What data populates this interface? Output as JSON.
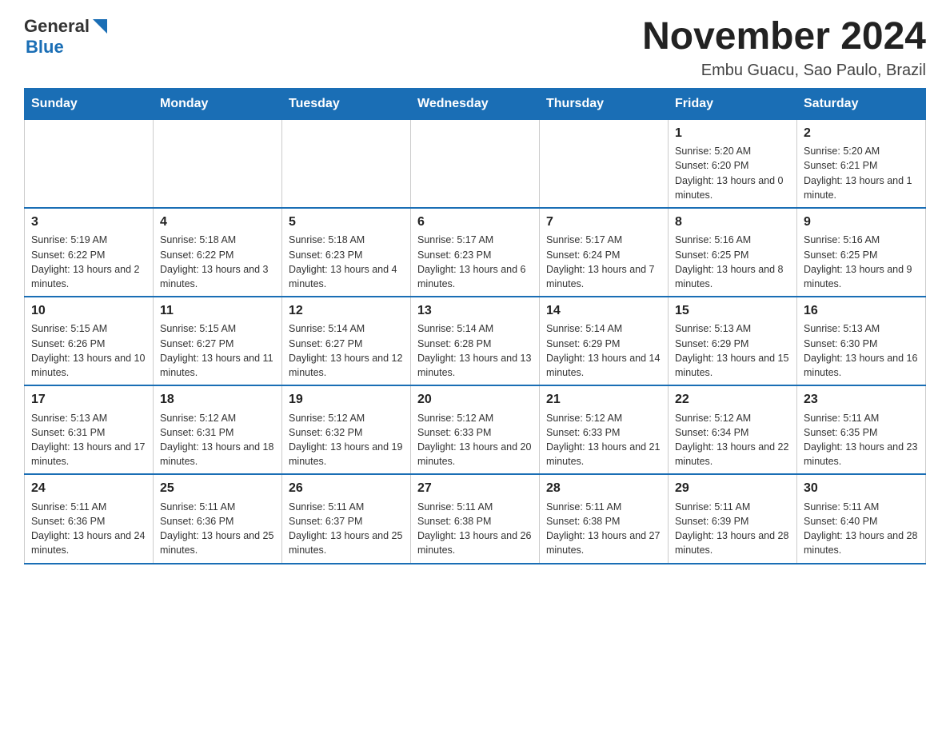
{
  "header": {
    "logo_general": "General",
    "logo_blue": "Blue",
    "month_title": "November 2024",
    "location": "Embu Guacu, Sao Paulo, Brazil"
  },
  "weekdays": [
    "Sunday",
    "Monday",
    "Tuesday",
    "Wednesday",
    "Thursday",
    "Friday",
    "Saturday"
  ],
  "weeks": [
    [
      {
        "day": "",
        "info": ""
      },
      {
        "day": "",
        "info": ""
      },
      {
        "day": "",
        "info": ""
      },
      {
        "day": "",
        "info": ""
      },
      {
        "day": "",
        "info": ""
      },
      {
        "day": "1",
        "info": "Sunrise: 5:20 AM\nSunset: 6:20 PM\nDaylight: 13 hours and 0 minutes."
      },
      {
        "day": "2",
        "info": "Sunrise: 5:20 AM\nSunset: 6:21 PM\nDaylight: 13 hours and 1 minute."
      }
    ],
    [
      {
        "day": "3",
        "info": "Sunrise: 5:19 AM\nSunset: 6:22 PM\nDaylight: 13 hours and 2 minutes."
      },
      {
        "day": "4",
        "info": "Sunrise: 5:18 AM\nSunset: 6:22 PM\nDaylight: 13 hours and 3 minutes."
      },
      {
        "day": "5",
        "info": "Sunrise: 5:18 AM\nSunset: 6:23 PM\nDaylight: 13 hours and 4 minutes."
      },
      {
        "day": "6",
        "info": "Sunrise: 5:17 AM\nSunset: 6:23 PM\nDaylight: 13 hours and 6 minutes."
      },
      {
        "day": "7",
        "info": "Sunrise: 5:17 AM\nSunset: 6:24 PM\nDaylight: 13 hours and 7 minutes."
      },
      {
        "day": "8",
        "info": "Sunrise: 5:16 AM\nSunset: 6:25 PM\nDaylight: 13 hours and 8 minutes."
      },
      {
        "day": "9",
        "info": "Sunrise: 5:16 AM\nSunset: 6:25 PM\nDaylight: 13 hours and 9 minutes."
      }
    ],
    [
      {
        "day": "10",
        "info": "Sunrise: 5:15 AM\nSunset: 6:26 PM\nDaylight: 13 hours and 10 minutes."
      },
      {
        "day": "11",
        "info": "Sunrise: 5:15 AM\nSunset: 6:27 PM\nDaylight: 13 hours and 11 minutes."
      },
      {
        "day": "12",
        "info": "Sunrise: 5:14 AM\nSunset: 6:27 PM\nDaylight: 13 hours and 12 minutes."
      },
      {
        "day": "13",
        "info": "Sunrise: 5:14 AM\nSunset: 6:28 PM\nDaylight: 13 hours and 13 minutes."
      },
      {
        "day": "14",
        "info": "Sunrise: 5:14 AM\nSunset: 6:29 PM\nDaylight: 13 hours and 14 minutes."
      },
      {
        "day": "15",
        "info": "Sunrise: 5:13 AM\nSunset: 6:29 PM\nDaylight: 13 hours and 15 minutes."
      },
      {
        "day": "16",
        "info": "Sunrise: 5:13 AM\nSunset: 6:30 PM\nDaylight: 13 hours and 16 minutes."
      }
    ],
    [
      {
        "day": "17",
        "info": "Sunrise: 5:13 AM\nSunset: 6:31 PM\nDaylight: 13 hours and 17 minutes."
      },
      {
        "day": "18",
        "info": "Sunrise: 5:12 AM\nSunset: 6:31 PM\nDaylight: 13 hours and 18 minutes."
      },
      {
        "day": "19",
        "info": "Sunrise: 5:12 AM\nSunset: 6:32 PM\nDaylight: 13 hours and 19 minutes."
      },
      {
        "day": "20",
        "info": "Sunrise: 5:12 AM\nSunset: 6:33 PM\nDaylight: 13 hours and 20 minutes."
      },
      {
        "day": "21",
        "info": "Sunrise: 5:12 AM\nSunset: 6:33 PM\nDaylight: 13 hours and 21 minutes."
      },
      {
        "day": "22",
        "info": "Sunrise: 5:12 AM\nSunset: 6:34 PM\nDaylight: 13 hours and 22 minutes."
      },
      {
        "day": "23",
        "info": "Sunrise: 5:11 AM\nSunset: 6:35 PM\nDaylight: 13 hours and 23 minutes."
      }
    ],
    [
      {
        "day": "24",
        "info": "Sunrise: 5:11 AM\nSunset: 6:36 PM\nDaylight: 13 hours and 24 minutes."
      },
      {
        "day": "25",
        "info": "Sunrise: 5:11 AM\nSunset: 6:36 PM\nDaylight: 13 hours and 25 minutes."
      },
      {
        "day": "26",
        "info": "Sunrise: 5:11 AM\nSunset: 6:37 PM\nDaylight: 13 hours and 25 minutes."
      },
      {
        "day": "27",
        "info": "Sunrise: 5:11 AM\nSunset: 6:38 PM\nDaylight: 13 hours and 26 minutes."
      },
      {
        "day": "28",
        "info": "Sunrise: 5:11 AM\nSunset: 6:38 PM\nDaylight: 13 hours and 27 minutes."
      },
      {
        "day": "29",
        "info": "Sunrise: 5:11 AM\nSunset: 6:39 PM\nDaylight: 13 hours and 28 minutes."
      },
      {
        "day": "30",
        "info": "Sunrise: 5:11 AM\nSunset: 6:40 PM\nDaylight: 13 hours and 28 minutes."
      }
    ]
  ]
}
